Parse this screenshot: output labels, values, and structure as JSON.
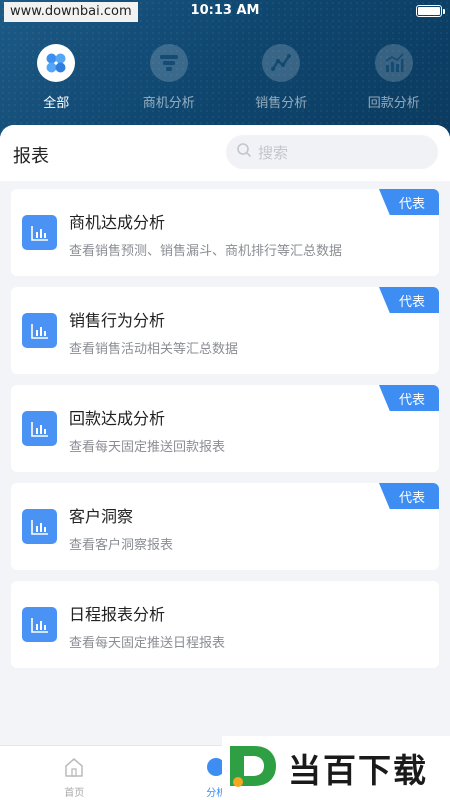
{
  "status_bar": {
    "watermark": "www.downbai.com",
    "time": "10:13 AM"
  },
  "categories": [
    {
      "label": "全部",
      "icon": "clover-icon",
      "active": true
    },
    {
      "label": "商机分析",
      "icon": "funnel-icon",
      "active": false
    },
    {
      "label": "销售分析",
      "icon": "line-trend-icon",
      "active": false
    },
    {
      "label": "回款分析",
      "icon": "bar-trend-icon",
      "active": false
    }
  ],
  "panel": {
    "title": "报表",
    "search_placeholder": "搜索"
  },
  "reports": [
    {
      "title": "商机达成分析",
      "desc": "查看销售预测、销售漏斗、商机排行等汇总数据",
      "badge": "代表"
    },
    {
      "title": "销售行为分析",
      "desc": "查看销售活动相关等汇总数据",
      "badge": "代表"
    },
    {
      "title": "回款达成分析",
      "desc": "查看每天固定推送回款报表",
      "badge": "代表"
    },
    {
      "title": "客户洞察",
      "desc": "查看客户洞察报表",
      "badge": "代表"
    },
    {
      "title": "日程报表分析",
      "desc": "查看每天固定推送日程报表",
      "badge": ""
    }
  ],
  "tabbar": [
    {
      "label": "首页",
      "icon": "home-icon"
    },
    {
      "label": "分析",
      "icon": "analysis-icon"
    }
  ],
  "watermark_logo": "当百下载",
  "colors": {
    "accent": "#3d8df3",
    "header": "#0f4770",
    "card_icon": "#4a93f5"
  }
}
